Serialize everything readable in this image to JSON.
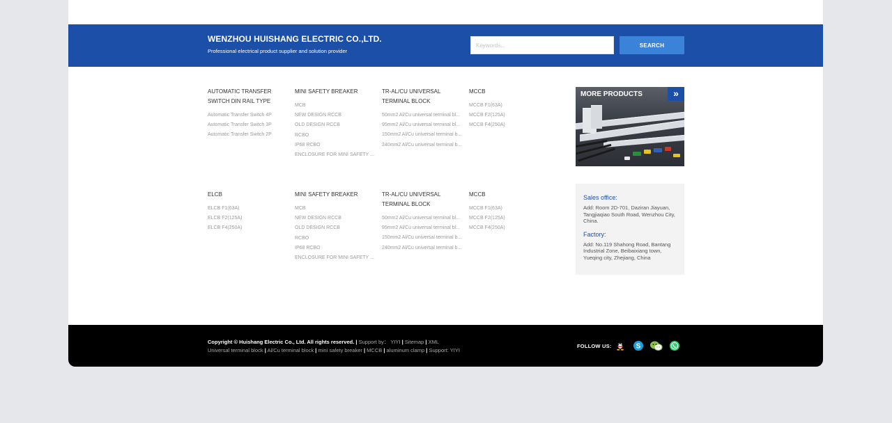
{
  "header": {
    "company_name": "WENZHOU HUISHANG ELECTRIC CO.,LTD.",
    "slogan": "Professional electrical product supplier and solution provider",
    "search_placeholder": "Keywords...",
    "search_button": "SEARCH"
  },
  "columns": [
    {
      "title": "AUTOMATIC TRANSFER SWITCH DIN RAIL TYPE",
      "items": [
        "Automatic Transfer Switch 4P",
        "Automatic Transfer Switch 3P",
        "Automatic Transfer Switch 2P"
      ]
    },
    {
      "title": "MINI SAFETY BREAKER",
      "items": [
        "MCB",
        "NEW DESIGN RCCB",
        "OLD DESIGN RCCB",
        "RCBO",
        "IP68 RCBO",
        "ENCLOSURE FOR MINI SAFETY ..."
      ]
    },
    {
      "title": "TR-AL/CU UNIVERSAL TERMINAL BLOCK",
      "items": [
        "50mm2 Al/Cu universal terminal bl...",
        "95mm2 Al/Cu universal terminal bl...",
        "150mm2 Al/Cu universal terminal b...",
        "240mm2 Al/Cu universal terminal b..."
      ]
    },
    {
      "title": "MCCB",
      "items": [
        "MCCB F1(63A)",
        "MCCB F2(125A)",
        "MCCB F4(250A)"
      ]
    },
    {
      "title": "ELCB",
      "items": [
        "ELCB F1(63A)",
        "ELCB F2(125A)",
        "ELCB F4(250A)"
      ]
    },
    {
      "title": "MINI SAFETY BREAKER",
      "items": [
        "MCB",
        "NEW DESIGN RCCB",
        "OLD DESIGN RCCB",
        "RCBO",
        "IP68 RCBO",
        "ENCLOSURE FOR MINI SAFETY ..."
      ]
    },
    {
      "title": "TR-AL/CU UNIVERSAL TERMINAL BLOCK",
      "items": [
        "50mm2 Al/Cu universal terminal bl...",
        "95mm2 Al/Cu universal terminal bl...",
        "150mm2 Al/Cu universal terminal b...",
        "240mm2 Al/Cu universal terminal b..."
      ]
    },
    {
      "title": "MCCB",
      "items": [
        "MCCB F1(63A)",
        "MCCB F2(125A)",
        "MCCB F4(250A)"
      ]
    }
  ],
  "more_products": {
    "title": "MORE PRODUCTS",
    "arrow_icon": "double-chevron-right-icon"
  },
  "offices": {
    "sales_heading": "Sales office:",
    "sales_address": "Add: Room 2D-701, Daziran Jiayuan, Tangjiaqiao South Road, Wenzhou City, China.",
    "factory_heading": "Factory:",
    "factory_address": "Add: No.119 Shahong Road, Bantang Industrial Zone, Beibaixiang town, Yueqing city, Zhejiang, China"
  },
  "footer": {
    "copyright": "Copyright © Huishang Electric Co., Ltd. All rights reserved.",
    "sep": "|",
    "support_label": "Support by：",
    "support_name": "YIYI",
    "sitemap": "Sitemap",
    "xml": "XML",
    "links": [
      "Universal terminal block",
      "Al/Cu terminal block",
      "mini safety breaker",
      "MCCB",
      "aluminum clamp"
    ],
    "support2": "Support: YIYI",
    "follow_label": "FOLLOW US:",
    "social_icons": [
      "qq-icon",
      "skype-icon",
      "wechat-icon",
      "whatsapp-icon"
    ]
  },
  "colors": {
    "brand_blue": "#1c4fa8",
    "search_button": "#3b82d9",
    "background": "#e6e7eb",
    "footer": "#000000"
  }
}
